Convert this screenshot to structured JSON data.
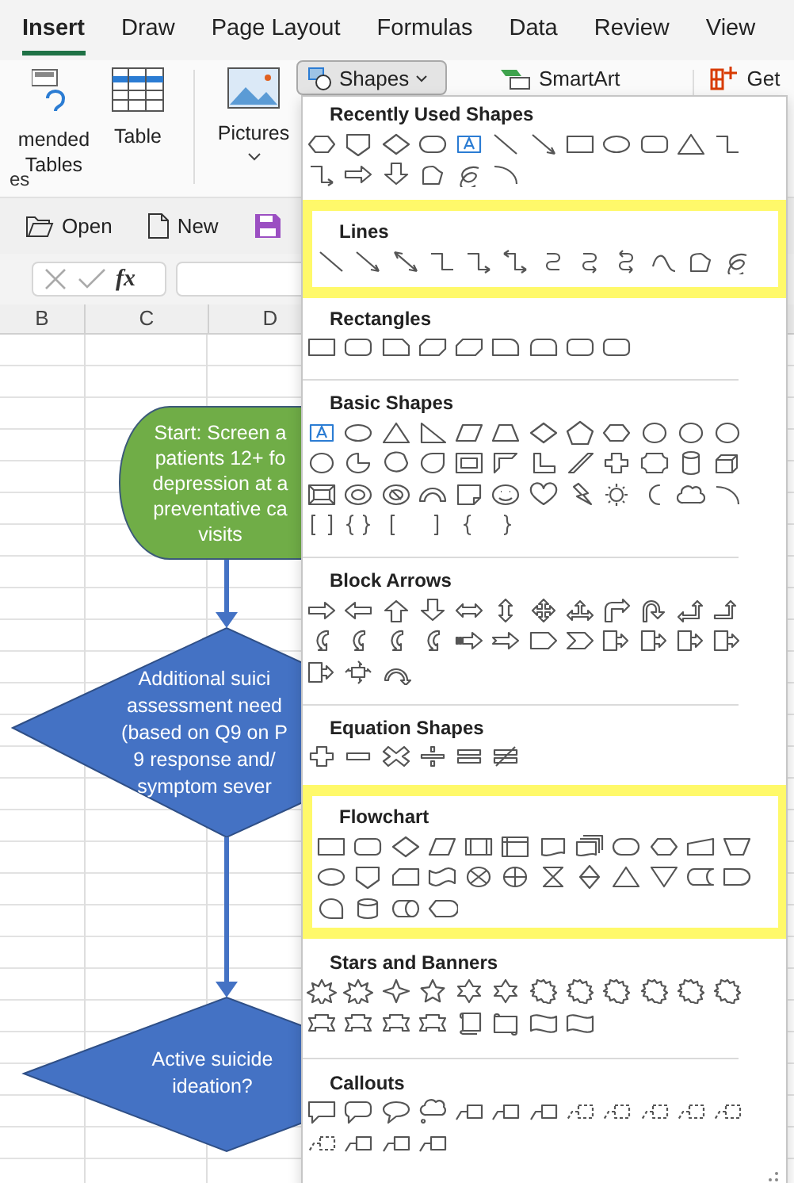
{
  "tabs": [
    {
      "label": "Insert",
      "selected": true
    },
    {
      "label": "Draw",
      "selected": false
    },
    {
      "label": "Page Layout",
      "selected": false
    },
    {
      "label": "Formulas",
      "selected": false
    },
    {
      "label": "Data",
      "selected": false
    },
    {
      "label": "Review",
      "selected": false
    },
    {
      "label": "View",
      "selected": false
    }
  ],
  "ribbon": {
    "recommended_tables": "mended\nTables",
    "table": "Table",
    "pictures": "Pictures",
    "shapes": {
      "label": "Shapes",
      "expanded": true
    },
    "smartart": "SmartArt",
    "get": "Get",
    "group_label": "es"
  },
  "quick_access": [
    {
      "kind": "open",
      "label": "Open"
    },
    {
      "kind": "new",
      "label": "New"
    },
    {
      "kind": "save"
    }
  ],
  "formula_bar": {
    "function_label": "fx"
  },
  "columns": [
    "B",
    "C",
    "D"
  ],
  "flowchart": [
    {
      "kind": "terminator",
      "text": "Start: Screen a\npatients 12+ fo\ndepression at a\npreventative ca\nvisits"
    },
    {
      "kind": "decision",
      "text": "Additional suici\nassessment need\n(based on Q9 on P\n9 response and/\nsymptom sever"
    },
    {
      "kind": "decision",
      "text": "Active suicide\nideation?"
    }
  ],
  "shapes_menu": {
    "sections": [
      {
        "kind": "recent",
        "title": "Recently Used Shapes",
        "highlighted": false
      },
      {
        "kind": "lines",
        "title": "Lines",
        "highlighted": true
      },
      {
        "kind": "rectangles",
        "title": "Rectangles",
        "highlighted": false
      },
      {
        "kind": "basic",
        "title": "Basic Shapes",
        "highlighted": false
      },
      {
        "kind": "block",
        "title": "Block Arrows",
        "highlighted": false
      },
      {
        "kind": "equation",
        "title": "Equation Shapes",
        "highlighted": false
      },
      {
        "kind": "flowchart",
        "title": "Flowchart",
        "highlighted": true
      },
      {
        "kind": "stars",
        "title": "Stars and Banners",
        "highlighted": false
      },
      {
        "kind": "callouts",
        "title": "Callouts",
        "highlighted": false
      }
    ]
  }
}
